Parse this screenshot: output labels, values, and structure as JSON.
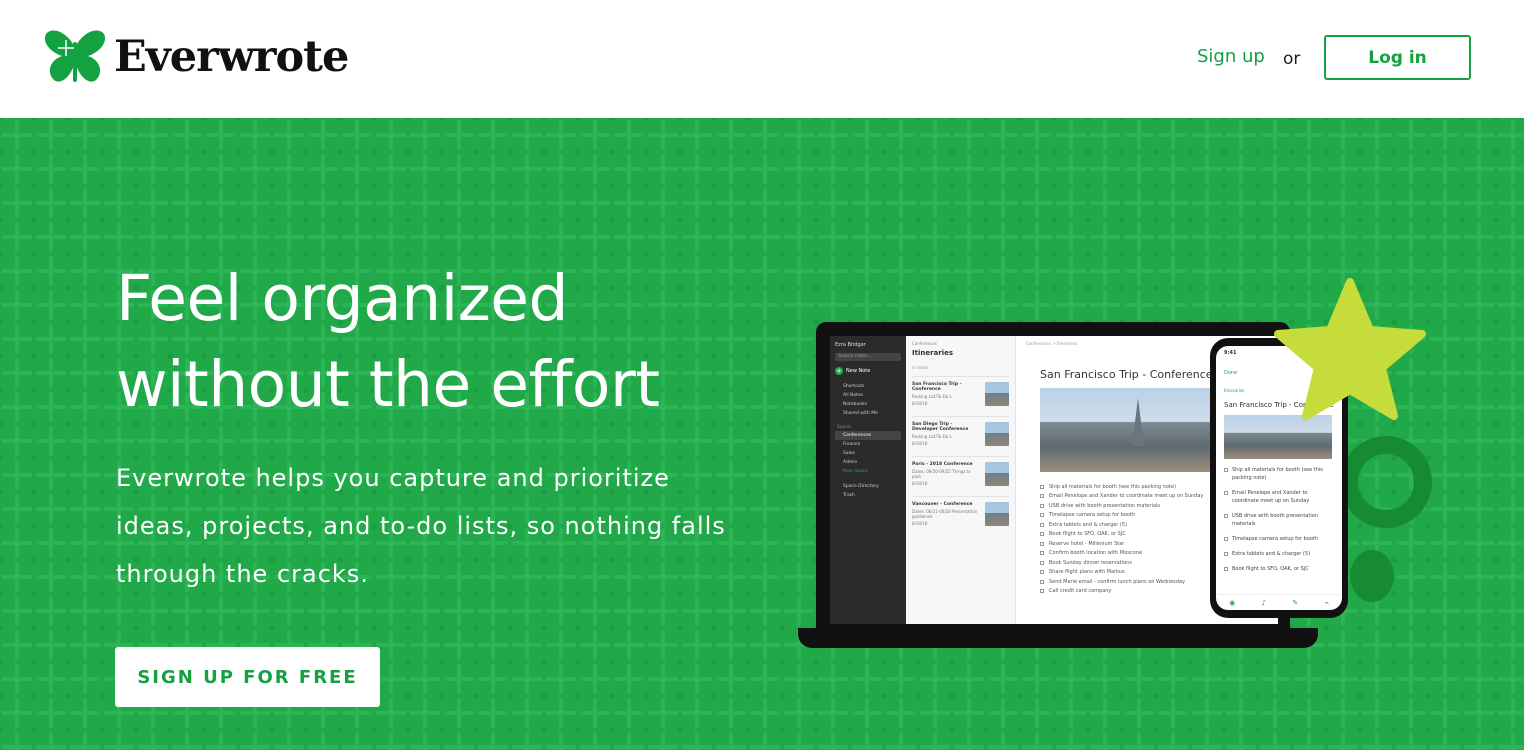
{
  "header": {
    "brand": "Everwrote",
    "signup_label": "Sign up",
    "or_label": "or",
    "login_label": "Log in"
  },
  "hero": {
    "headline_line1": "Feel organized",
    "headline_line2": "without the effort",
    "subtext": "Everwrote helps you capture and prioritize ideas, projects, and to-do lists, so nothing falls through the cracks.",
    "cta_label": "SIGN UP FOR FREE"
  },
  "app_preview": {
    "user": "Ezra Bridger",
    "search_placeholder": "Search notes...",
    "new_note": "New Note",
    "sidebar": [
      "Shortcuts",
      "All Notes",
      "Notebooks",
      "Shared with Me"
    ],
    "spaces_heading": "Spaces",
    "spaces": [
      "Conferences",
      "Finance",
      "Sales",
      "Admin",
      "New Space"
    ],
    "sidebar_footer": [
      "Space Directory",
      "Trash"
    ],
    "breadcrumb": "Conferences",
    "notebook_title": "Itineraries",
    "note_count": "4 notes",
    "notes": [
      {
        "title": "San Francisco Trip - Conference",
        "sub": "Packing List/To-Do's",
        "date": "8/10/18"
      },
      {
        "title": "San Diego Trip - Developer Conference",
        "sub": "Packing List/To-Do's",
        "date": "8/10/18"
      },
      {
        "title": "Paris - 2018 Conference",
        "sub": "Dates: 09/20-09/25 Things to pack",
        "date": "8/10/18"
      },
      {
        "title": "Vancouver - Conference",
        "sub": "Dates: 06/21-06/28 Presentation guidelines",
        "date": "8/10/18"
      }
    ],
    "editor_crumb": "Conferences  >  Itineraries",
    "share": "Share",
    "editor_title": "San Francisco Trip - Conference",
    "checklist": [
      "Ship all materials for booth (see this packing note)",
      "Email Penelope and Xander to coordinate meet up on Sunday",
      "USB drive with booth presentation materials",
      "Timelapse camera setup for booth",
      "Extra tablets and & charger (5)",
      "Book flight to SFO, OAK, or SJC",
      "Reserve hotel - Millenium Star",
      "Confirm booth location with Moscone",
      "Book Sunday dinner reservations",
      "Share flight plans with Markus",
      "Send Marie email - confirm lunch plans on Wednesday",
      "Call credit card company"
    ],
    "phone": {
      "time": "9:41",
      "done": "Done",
      "notebook": "Itineraries",
      "title": "San Francisco Trip - Conference",
      "checklist": [
        "Ship all materials for booth (see this packing note)",
        "Email Penelope and Xander to coordinate meet up on Sunday",
        "USB drive with booth presentation materials",
        "Timelapse camera setup for booth",
        "Extra tablets and & charger (5)",
        "Book flight to SFO, OAK, or SJC"
      ]
    }
  },
  "colors": {
    "brand_green": "#14a142",
    "hero_bg": "#20a849",
    "star": "#c5dc3a",
    "ring": "#178a36"
  }
}
